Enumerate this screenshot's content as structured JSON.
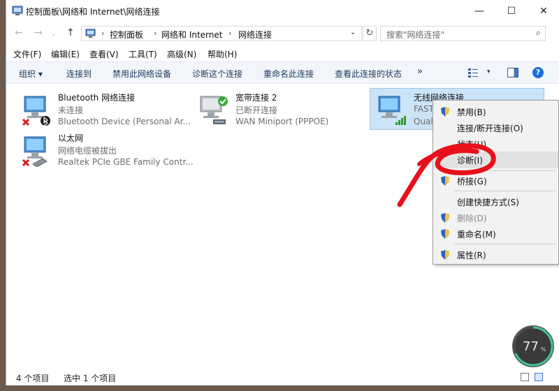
{
  "window": {
    "title": "控制面板\\网络和 Internet\\网络连接",
    "min_glyph": "—",
    "max_glyph": "☐",
    "close_glyph": "✕"
  },
  "address": {
    "back_glyph": "←",
    "forward_glyph": "→",
    "recent_glyph": "⌄",
    "up_glyph": "↑",
    "sep_glyph": "›",
    "crumbs": [
      "控制面板",
      "网络和 Internet",
      "网络连接"
    ],
    "dropdown_glyph": "⌄",
    "refresh_glyph": "↻",
    "search_placeholder": "搜索\"网络连接\"",
    "search_glyph": "⌕"
  },
  "menubar": [
    "文件(F)",
    "编辑(E)",
    "查看(V)",
    "工具(T)",
    "高级(N)",
    "帮助(H)"
  ],
  "commands": {
    "organize": "组织 ▾",
    "items": [
      "连接到",
      "禁用此网络设备",
      "诊断这个连接",
      "重命名此连接",
      "查看此连接的状态"
    ],
    "more": "»",
    "view_drop": "▾",
    "help": "?"
  },
  "connections": [
    {
      "name": "Bluetooth 网络连接",
      "status": "未连接",
      "device": "Bluetooth Device (Personal Ar...",
      "state_icon": "red-x-icon",
      "selected": false
    },
    {
      "name": "宽带连接 2",
      "status": "已断开连接",
      "device": "WAN Miniport (PPPOE)",
      "state_icon": "green-check-icon",
      "selected": false
    },
    {
      "name": "无线网络连接",
      "status": "FAST_",
      "device": "Qualc",
      "state_icon": "wifi-bars-icon",
      "selected": true
    },
    {
      "name": "以太网",
      "status": "网络电缆被拔出",
      "device": "Realtek PCIe GBE Family Contr...",
      "state_icon": "red-x-icon",
      "selected": false
    }
  ],
  "context_menu": [
    {
      "label": "禁用(B)",
      "shield": true,
      "disabled": false,
      "hover": false
    },
    {
      "label": "连接/断开连接(O)",
      "shield": false,
      "disabled": false,
      "hover": false
    },
    {
      "label": "状态(U)",
      "shield": false,
      "disabled": false,
      "hover": false
    },
    {
      "label": "诊断(I)",
      "shield": false,
      "disabled": false,
      "hover": true
    },
    {
      "label": "桥接(G)",
      "shield": true,
      "disabled": false,
      "hover": false
    },
    {
      "label": "创建快捷方式(S)",
      "shield": false,
      "disabled": false,
      "hover": false
    },
    {
      "label": "删除(D)",
      "shield": true,
      "disabled": true,
      "hover": false
    },
    {
      "label": "重命名(M)",
      "shield": true,
      "disabled": false,
      "hover": false
    },
    {
      "label": "属性(R)",
      "shield": true,
      "disabled": false,
      "hover": false
    }
  ],
  "statusbar": {
    "count": "4 个项目",
    "selected": "选中 1 个项目"
  },
  "speed_widget": {
    "value": "77",
    "unit": "%"
  },
  "colors": {
    "accent": "#1a6ed8",
    "selection": "#cce4f7",
    "annotation": "#e8101a"
  }
}
